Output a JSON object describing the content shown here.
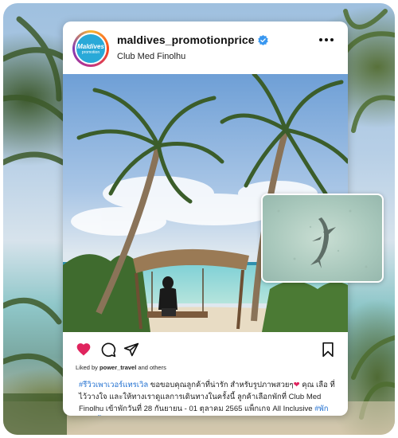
{
  "post": {
    "username": "maldives_promotionprice",
    "location": "Club Med Finolhu",
    "avatar_line1": "Maldives",
    "avatar_line2": "promotion",
    "verified": true
  },
  "actions": {
    "like_icon": "heart-filled-icon",
    "comment_icon": "comment-icon",
    "share_icon": "share-icon",
    "save_icon": "bookmark-icon",
    "like_color": "#e0245e"
  },
  "likes": {
    "prefix": "Liked by",
    "user": "power_travel",
    "suffix": "and others"
  },
  "caption": {
    "hashtag1": "#รีวิวเพาเวอร์แทรเวิล",
    "text1": " ขอขอบคุณลูกค้าที่น่ารัก สำหรับรูปภาพสวยๆ",
    "heart": "❤",
    "text2": "คุณ เลือ ที่ไว้วางใจ และให้ทางเราดูแลการเดินทางในครั้งนี้ ลูกค้าเลือกพักที่ Club Med Finolhu เข้าพักวันที่ 28 กันยายน - 01 ตุลาคม 2565 แพ็กเกจ All Inclusive ",
    "hashtag2": "#พักกลางน้ำ"
  },
  "colors": {
    "brand_blue": "#29a9d8",
    "hashtag": "#1f6fd0",
    "verified": "#3897f0"
  }
}
